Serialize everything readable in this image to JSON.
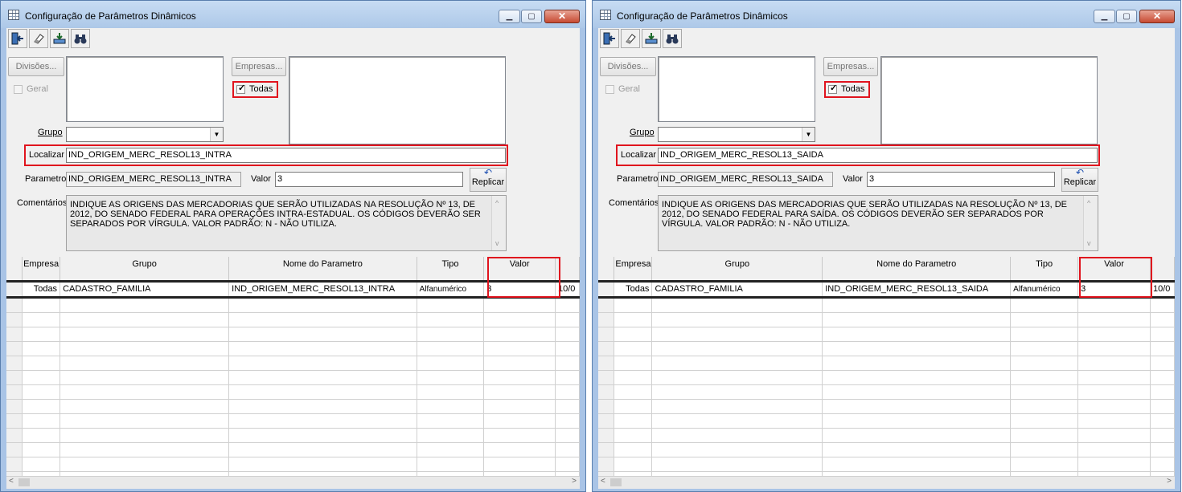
{
  "windows": [
    {
      "title": "Configuração de Parâmetros Dinâmicos",
      "toolbar": [
        "exit-icon",
        "eraser-icon",
        "import-icon",
        "binoculars-icon"
      ],
      "divisoes_label": "Divisões...",
      "geral_label": "Geral",
      "empresas_label": "Empresas...",
      "todas_label": "Todas",
      "grupo_label": "Grupo",
      "grupo_value": "",
      "localizar_label": "Localizar",
      "localizar_value": "IND_ORIGEM_MERC_RESOL13_INTRA",
      "parametro_label": "Parametro",
      "parametro_value": "IND_ORIGEM_MERC_RESOL13_INTRA",
      "valor_label": "Valor",
      "valor_value": "3",
      "replicar_label": "Replicar",
      "comentarios_label": "Comentários",
      "comentarios_text": "INDIQUE AS ORIGENS DAS MERCADORIAS QUE SERÃO UTILIZADAS NA RESOLUÇÃO Nº 13, DE 2012, DO SENADO FEDERAL PARA OPERAÇÕES INTRA-ESTADUAL. OS CÓDIGOS DEVERÃO SER SEPARADOS POR VÍRGULA. VALOR PADRÃO: N - NÃO UTILIZA.",
      "columns": [
        "Empresa",
        "Grupo",
        "Nome do Parametro",
        "Tipo",
        "Valor"
      ],
      "row": {
        "empresa": "Todas",
        "grupo": "CADASTRO_FAMILIA",
        "nome": "IND_ORIGEM_MERC_RESOL13_INTRA",
        "tipo": "Alfanumérico",
        "valor": "3",
        "extra": "10/0"
      }
    },
    {
      "title": "Configuração de Parâmetros Dinâmicos",
      "toolbar": [
        "exit-icon",
        "eraser-icon",
        "import-icon",
        "binoculars-icon"
      ],
      "divisoes_label": "Divisões...",
      "geral_label": "Geral",
      "empresas_label": "Empresas...",
      "todas_label": "Todas",
      "grupo_label": "Grupo",
      "grupo_value": "",
      "localizar_label": "Localizar",
      "localizar_value": "IND_ORIGEM_MERC_RESOL13_SAIDA",
      "parametro_label": "Parametro",
      "parametro_value": "IND_ORIGEM_MERC_RESOL13_SAIDA",
      "valor_label": "Valor",
      "valor_value": "3",
      "replicar_label": "Replicar",
      "comentarios_label": "Comentários",
      "comentarios_text": "INDIQUE AS ORIGENS DAS MERCADORIAS QUE SERÃO UTILIZADAS NA RESOLUÇÃO Nº 13, DE 2012, DO SENADO FEDERAL PARA SAÍDA. OS CÓDIGOS DEVERÃO SER SEPARADOS POR VÍRGULA. VALOR PADRÃO: N - NÃO UTILIZA.",
      "columns": [
        "Empresa",
        "Grupo",
        "Nome do Parametro",
        "Tipo",
        "Valor"
      ],
      "row": {
        "empresa": "Todas",
        "grupo": "CADASTRO_FAMILIA",
        "nome": "IND_ORIGEM_MERC_RESOL13_SAIDA",
        "tipo": "Alfanumérico",
        "valor": "3",
        "extra": "10/0"
      }
    }
  ],
  "colors": {
    "highlight": "#e0141e",
    "title_bg": "#c7dcf3",
    "close_btn": "#c74a32"
  }
}
